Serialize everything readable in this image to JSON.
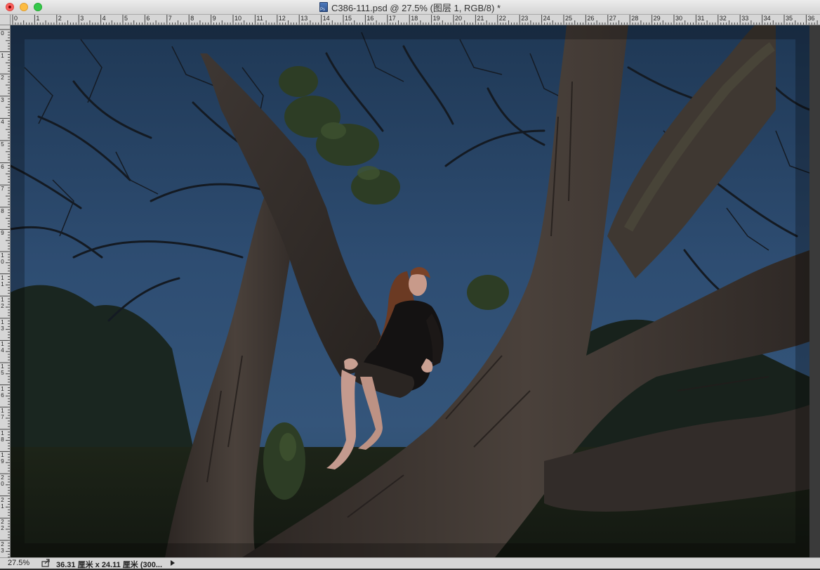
{
  "window": {
    "title": "C386-111.psd @ 27.5% (图层 1, RGB/8) *"
  },
  "ruler_horizontal": {
    "labels": [
      "0",
      "1",
      "2",
      "3",
      "4",
      "5",
      "6",
      "7",
      "8",
      "9",
      "10",
      "11",
      "12",
      "13",
      "14",
      "15",
      "16",
      "17",
      "18",
      "19",
      "20",
      "21",
      "22",
      "23",
      "24",
      "25",
      "26",
      "27",
      "28",
      "29",
      "30",
      "31",
      "32",
      "33",
      "34",
      "35",
      "36"
    ]
  },
  "ruler_vertical": {
    "labels": [
      "0",
      "1",
      "2",
      "3",
      "4",
      "5",
      "6",
      "7",
      "8",
      "9",
      "10",
      "11",
      "12",
      "13",
      "14",
      "15",
      "16",
      "17",
      "18",
      "19",
      "20",
      "21",
      "22",
      "23"
    ]
  },
  "canvas": {
    "description_icon": "photo-canvas",
    "colors": {
      "sky": "#2c4a6e",
      "ground": "#1c2219",
      "bark": "#3b3430"
    }
  },
  "statusbar": {
    "zoom": "27.5%",
    "doc_size": "36.31 厘米 x 24.11 厘米 (300..."
  }
}
